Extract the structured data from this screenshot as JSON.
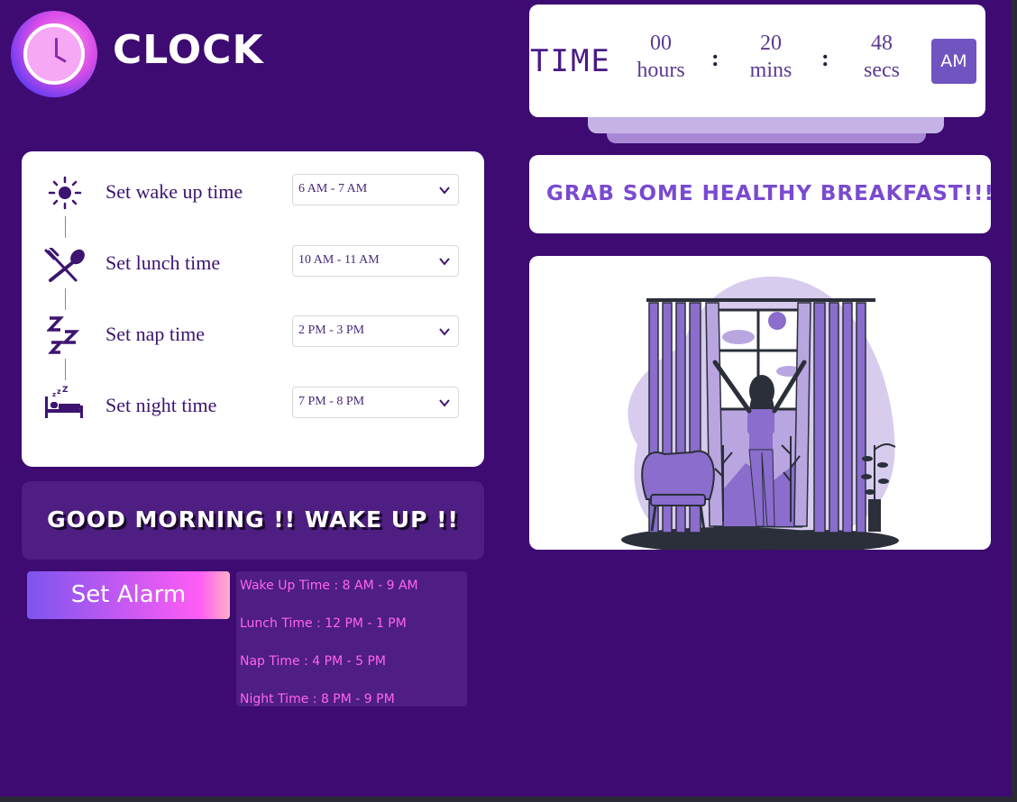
{
  "app": {
    "title": "CLOCK"
  },
  "time": {
    "label": "TIME",
    "hours": "00",
    "hours_unit": "hours",
    "mins": "20",
    "mins_unit": "mins",
    "secs": "48",
    "secs_unit": "secs",
    "separator": ":",
    "ampm": "AM"
  },
  "message": "GRAB SOME HEALTHY BREAKFAST!!!",
  "settings": [
    {
      "label": "Set wake up time",
      "value": "6 AM - 7 AM",
      "icon": "sun-icon"
    },
    {
      "label": "Set lunch time",
      "value": "10 AM - 11 AM",
      "icon": "fork-spoon-icon"
    },
    {
      "label": "Set nap time",
      "value": "2 PM - 3 PM",
      "icon": "zzz-icon"
    },
    {
      "label": "Set night time",
      "value": "7 PM - 8 PM",
      "icon": "bed-icon"
    }
  ],
  "banner": "GOOD MORNING !! WAKE UP !!",
  "alarm_button": "Set Alarm",
  "alarms": [
    "Wake Up Time : 8 AM - 9 AM",
    "Lunch Time : 12 PM - 1 PM",
    "Nap Time : 4 PM - 5 PM",
    "Night Time : 8 PM - 9 PM"
  ],
  "colors": {
    "background": "#3d0b72",
    "accent": "#7054c0",
    "pink": "#ff64ef",
    "card": "#ffffff"
  }
}
